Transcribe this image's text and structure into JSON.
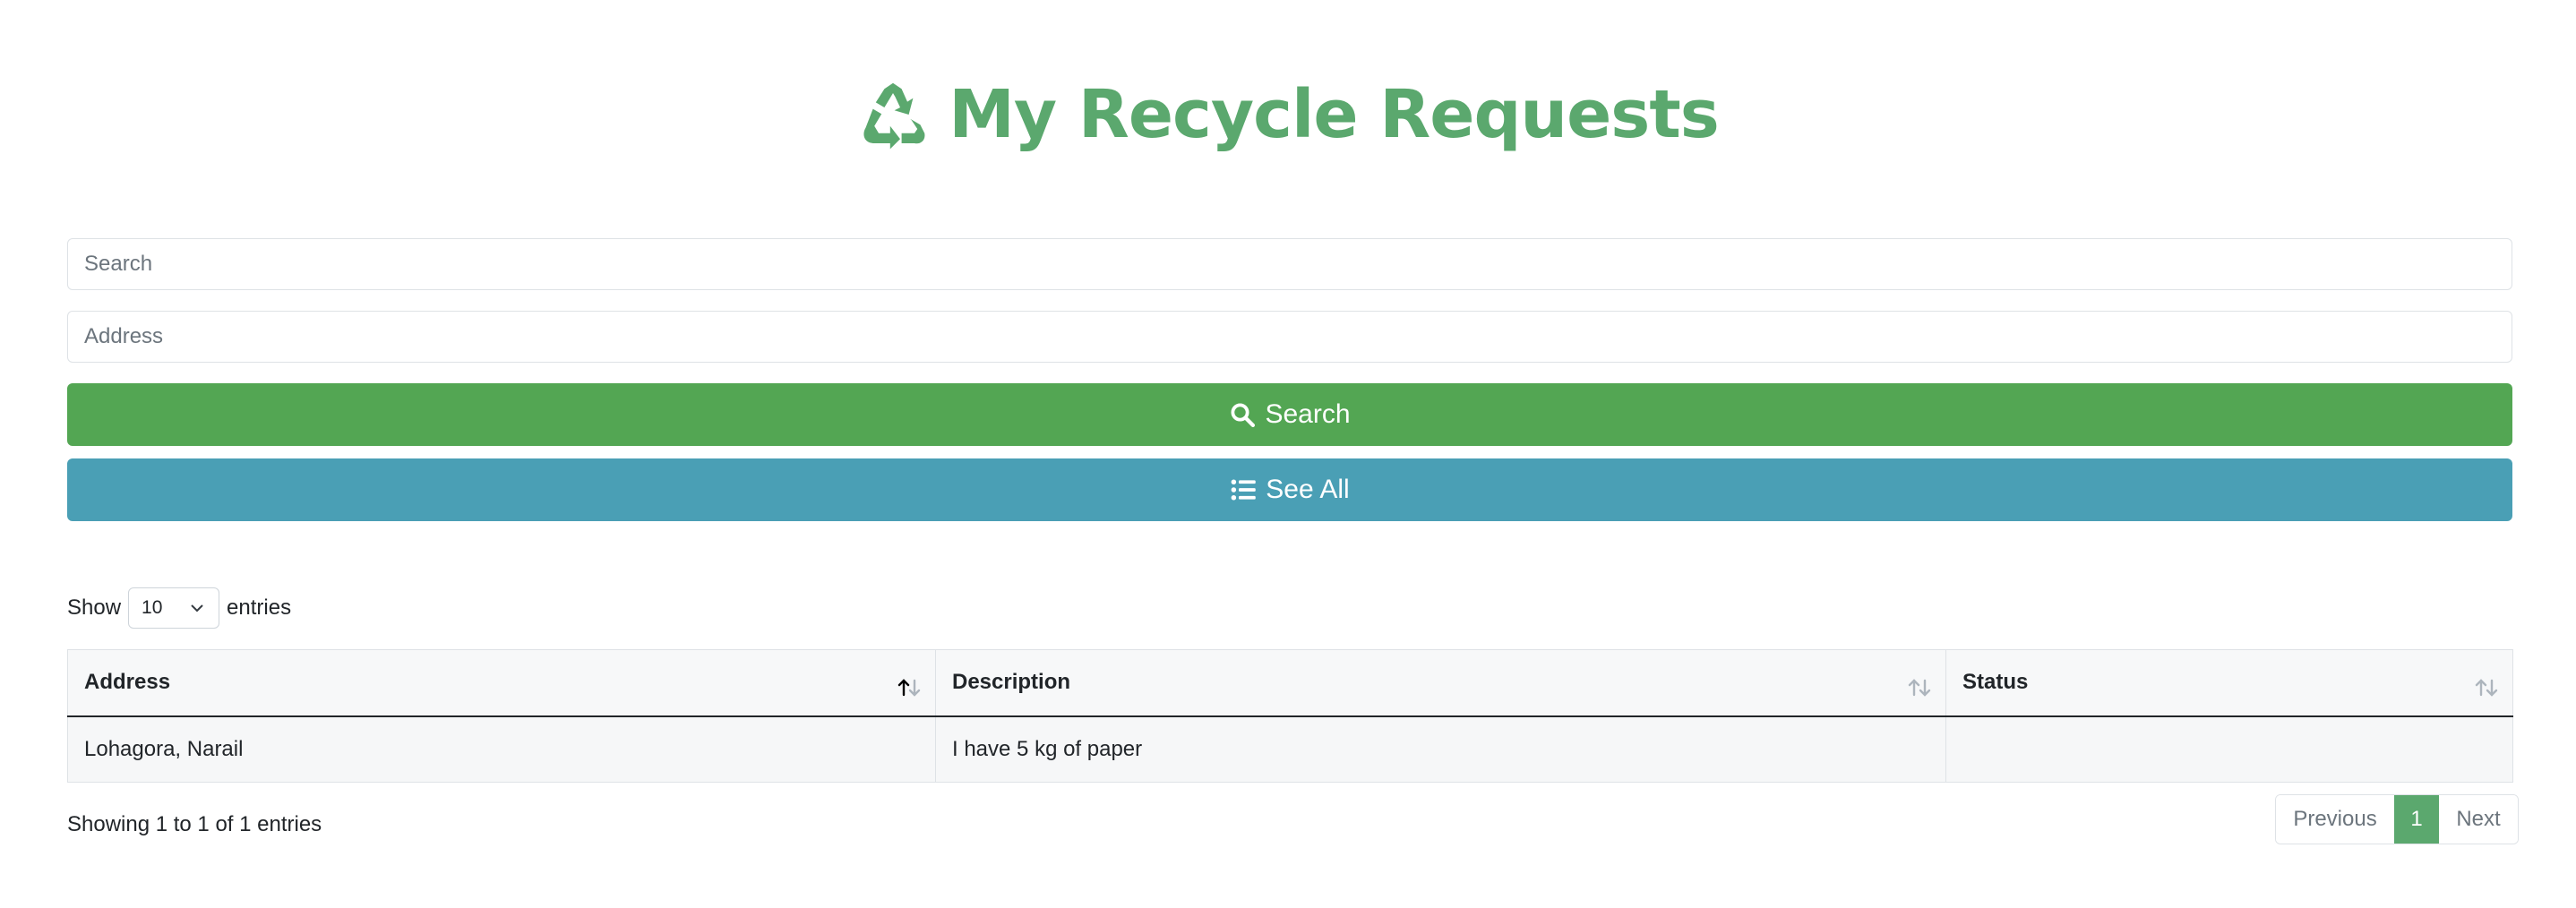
{
  "header": {
    "title": "My Recycle Requests",
    "icon": "recycle-icon",
    "color": "#5ba86e"
  },
  "filters": {
    "search_placeholder": "Search",
    "address_placeholder": "Address"
  },
  "buttons": {
    "search_label": "Search",
    "search_icon": "search-icon",
    "search_color": "#53a653",
    "see_all_label": "See All",
    "see_all_icon": "list-icon",
    "see_all_color": "#4a9fb5"
  },
  "table_controls": {
    "show_label": "Show",
    "page_size": "10",
    "entries_label": "entries"
  },
  "table": {
    "columns": [
      "Address",
      "Description",
      "Status"
    ],
    "sorted_column": "Address",
    "rows": [
      {
        "address": "Lohagora, Narail",
        "description": "I have 5 kg of paper",
        "status": ""
      }
    ]
  },
  "footer": {
    "info": "Showing 1 to 1 of 1 entries",
    "pagination": {
      "previous_label": "Previous",
      "current_page": "1",
      "next_label": "Next"
    }
  }
}
